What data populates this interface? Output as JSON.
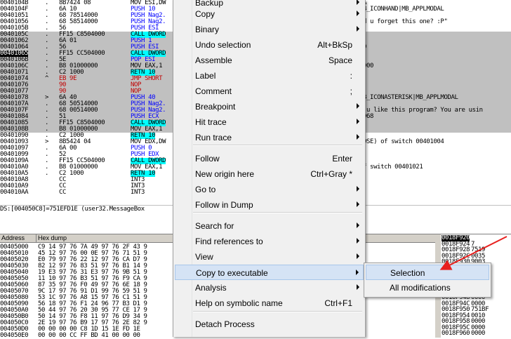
{
  "disasm": {
    "rows": [
      {
        "addr": "0040104B",
        "mark": ".",
        "hex": "8B7424 08",
        "cmd": "MOV ESI,DW",
        "cmt": "FA",
        "sel": false
      },
      {
        "addr": "0040104F",
        "mark": ".",
        "hex": "6A 10",
        "cmd": "PUSH 10",
        "cmt": "MB_ICONHAND|MB_APPLMODAL",
        "sel": false
      },
      {
        "addr": "00401051",
        "mark": ".",
        "hex": "68 78514000",
        "cmd": "PUSH Nag2.",
        "cmt": "",
        "sel": false
      },
      {
        "addr": "00401056",
        "mark": ".",
        "hex": "68 58514000",
        "cmd": "PUSH Nag2.",
        "cmt": "id u forget this one? :P\"",
        "sel": false
      },
      {
        "addr": "0040105B",
        "mark": ".",
        "hex": "56",
        "cmd": "PUSH ESI",
        "cmt": "",
        "sel": false
      },
      {
        "addr": "0040105C",
        "mark": ".",
        "hex": "FF15 C8504000",
        "cmd": "CALL DWORD",
        "cmt": "",
        "sel": true
      },
      {
        "addr": "00401062",
        "mark": ".",
        "hex": "6A 01",
        "cmd": "PUSH 1",
        "cmt": "",
        "sel": true
      },
      {
        "addr": "00401064",
        "mark": ".",
        "hex": "56",
        "cmd": "PUSH ESI",
        "cmt": "30",
        "sel": true
      },
      {
        "addr": "00401065",
        "mark": ".",
        "hex": "FF15 CC504000",
        "cmd": "CALL DWORD",
        "cmt": "",
        "sel": true
      },
      {
        "addr": "0040106B",
        "mark": ".",
        "hex": "5E",
        "cmd": "POP ESI",
        "cmt": "",
        "sel": true
      },
      {
        "addr": "0040106C",
        "mark": ".",
        "hex": "B8 01000000",
        "cmd": "MOV EAX,1",
        "cmt": "1000",
        "sel": true
      },
      {
        "addr": "00401071",
        "mark": ".",
        "hex": "C2 1000",
        "cmd": "RETN 10",
        "cmt": "",
        "sel": true
      },
      {
        "addr": "00401074",
        "mark": "^",
        "hex": "EB 9E",
        "cmd": "JMP SHORT",
        "cmt": "",
        "sel": true
      },
      {
        "addr": "00401076",
        "mark": "",
        "hex": "90",
        "cmd": "NOP",
        "cmt": "",
        "sel": true
      },
      {
        "addr": "00401077",
        "mark": "",
        "hex": "90",
        "cmd": "NOP",
        "cmt": "",
        "sel": true
      },
      {
        "addr": "00401078",
        "mark": ">",
        "hex": "6A 40",
        "cmd": "PUSH 40",
        "cmt": "MB_ICONASTERISK|MB_APPLMODAL",
        "sel": true
      },
      {
        "addr": "0040107A",
        "mark": ".",
        "hex": "68 50514000",
        "cmd": "PUSH Nag2.",
        "cmt": "\"",
        "sel": true
      },
      {
        "addr": "0040107F",
        "mark": ".",
        "hex": "68 00514000",
        "cmd": "PUSH Nag2.",
        "cmt": "o u like this program? You are usin",
        "sel": true
      },
      {
        "addr": "00401084",
        "mark": ".",
        "hex": "51",
        "cmd": "PUSH ECX",
        "cmt": "0D68",
        "sel": true
      },
      {
        "addr": "00401085",
        "mark": ".",
        "hex": "FF15 C8504000",
        "cmd": "CALL DWORD",
        "cmt": "",
        "sel": true
      },
      {
        "addr": "0040108B",
        "mark": ".",
        "hex": "B8 01000000",
        "cmd": "MOV EAX,1",
        "cmt": "",
        "sel": true
      },
      {
        "addr": "00401090",
        "mark": ".",
        "hex": "C2 1000",
        "cmd": "RETN 10",
        "cmt": "",
        "sel": false
      },
      {
        "addr": "00401093",
        "mark": ">",
        "hex": "8B5424 04",
        "cmd": "MOV EDX,DW",
        "cmt": "LOSE) of switch 00401004",
        "sel": false
      },
      {
        "addr": "00401097",
        "mark": ".",
        "hex": "6A 00",
        "cmd": "PUSH 0",
        "cmt": "",
        "sel": false
      },
      {
        "addr": "00401099",
        "mark": ".",
        "hex": "52",
        "cmd": "PUSH EDX",
        "cmt": "",
        "sel": false
      },
      {
        "addr": "0040109A",
        "mark": ".",
        "hex": "FF15 CC504000",
        "cmd": "CALL DWORD",
        "cmt": "",
        "sel": false
      },
      {
        "addr": "004010A0",
        "mark": ".",
        "hex": "B8 01000000",
        "cmd": "MOV EAX,1",
        "cmt": "of switch 00401021",
        "sel": false
      },
      {
        "addr": "004010A5",
        "mark": ".",
        "hex": "C2 1000",
        "cmd": "RETN 10",
        "cmt": "",
        "sel": false
      },
      {
        "addr": "004010A8",
        "mark": "",
        "hex": "CC",
        "cmd": "INT3",
        "cmt": "",
        "sel": false
      },
      {
        "addr": "004010A9",
        "mark": "",
        "hex": "CC",
        "cmd": "INT3",
        "cmt": "",
        "sel": false
      },
      {
        "addr": "004010AA",
        "mark": "",
        "hex": "CC",
        "cmd": "INT3",
        "cmt": "",
        "sel": false
      }
    ],
    "current_addr": "00401065"
  },
  "infoline": "DS:[004050C8]=751EFD1E (user32.MessageBox",
  "dump": {
    "headers": {
      "address": "Address",
      "hex": "Hex dump"
    },
    "rows": [
      {
        "addr": "00405000",
        "hex": "C9 14 97 76 7A 49 97 76 2F 43 9"
      },
      {
        "addr": "00405010",
        "hex": "45 12 97 76 00 0E 97 76 71 51 9"
      },
      {
        "addr": "00405020",
        "hex": "E0 79 97 76 22 12 97 76 CA D7 9"
      },
      {
        "addr": "00405030",
        "hex": "82 12 97 76 83 51 97 76 B1 14 9"
      },
      {
        "addr": "00405040",
        "hex": "19 E3 97 76 31 E3 97 76 9B 51 9"
      },
      {
        "addr": "00405050",
        "hex": "11 10 97 76 B3 51 97 76 F9 CA 9"
      },
      {
        "addr": "00405060",
        "hex": "87 35 97 76 F0 49 97 76 6E 18 9"
      },
      {
        "addr": "00405070",
        "hex": "9C 17 97 76 91 D1 99 76 59 51 9"
      },
      {
        "addr": "00405080",
        "hex": "53 1C 97 76 A8 15 97 76 C1 51 9"
      },
      {
        "addr": "00405090",
        "hex": "56 18 97 76 F1 24 96 77 B3 D1 9"
      },
      {
        "addr": "004050A0",
        "hex": "50 44 97 76 20 30 95 77 CE 17 9"
      },
      {
        "addr": "004050B0",
        "hex": "50 14 97 76 F8 11 97 76 D9 34 9"
      },
      {
        "addr": "004050C0",
        "hex": "2E 19 97 76 B9 17 97 76 2E 82 9"
      },
      {
        "addr": "004050D0",
        "hex": "00 00 00 00 C8 1D 15 1E FD 1E"
      },
      {
        "addr": "004050E0",
        "hex": "00 00 00 CC FF BD 41 00 00 00"
      }
    ]
  },
  "stack": {
    "current": "0018F920",
    "rows": [
      {
        "addr": "0018F920",
        "val": "",
        "cur": true
      },
      {
        "addr": "0018F924",
        "val": "7",
        "cur": false
      },
      {
        "addr": "0018F928",
        "val": "7519",
        "cur": false
      },
      {
        "addr": "0018F92C",
        "val": "0035",
        "cur": false
      },
      {
        "addr": "0018F930",
        "val": "9003",
        "cur": false
      },
      {
        "addr": "0018F934",
        "val": "0035",
        "cur": false
      },
      {
        "addr": "0018F938",
        "val": "0035",
        "cur": false
      },
      {
        "addr": "0018F93C",
        "val": "0010",
        "cur": false
      },
      {
        "addr": "0018F940",
        "val": "DCBAA",
        "cur": false
      },
      {
        "addr": "0018F944",
        "val": "0018",
        "cur": false
      },
      {
        "addr": "0018F948",
        "val": "0000",
        "cur": false
      },
      {
        "addr": "0018F94C",
        "val": "0000",
        "cur": false
      },
      {
        "addr": "0018F950",
        "val": "751BF",
        "cur": false
      },
      {
        "addr": "0018F954",
        "val": "0010",
        "cur": false
      },
      {
        "addr": "0018F958",
        "val": "0000",
        "cur": false
      },
      {
        "addr": "0018F95C",
        "val": "0000",
        "cur": false
      },
      {
        "addr": "0018F960",
        "val": "0000",
        "cur": false
      }
    ]
  },
  "menu": {
    "items": [
      {
        "label": "Backup",
        "shortcut": "",
        "submenu": true
      },
      {
        "label": "Copy",
        "shortcut": "",
        "submenu": true
      },
      {
        "label": "Binary",
        "shortcut": "",
        "submenu": true
      },
      {
        "label": "Undo selection",
        "shortcut": "Alt+BkSp",
        "submenu": false
      },
      {
        "label": "Assemble",
        "shortcut": "Space",
        "submenu": false
      },
      {
        "label": "Label",
        "shortcut": ":",
        "submenu": false
      },
      {
        "label": "Comment",
        "shortcut": ";",
        "submenu": false
      },
      {
        "label": "Breakpoint",
        "shortcut": "",
        "submenu": true
      },
      {
        "label": "Hit trace",
        "shortcut": "",
        "submenu": true
      },
      {
        "label": "Run trace",
        "shortcut": "",
        "submenu": true
      },
      {
        "label": "Follow",
        "shortcut": "Enter",
        "submenu": false
      },
      {
        "label": "New origin here",
        "shortcut": "Ctrl+Gray *",
        "submenu": false
      },
      {
        "label": "Go to",
        "shortcut": "",
        "submenu": true
      },
      {
        "label": "Follow in Dump",
        "shortcut": "",
        "submenu": true
      },
      {
        "label": "Search for",
        "shortcut": "",
        "submenu": true
      },
      {
        "label": "Find references to",
        "shortcut": "",
        "submenu": true
      },
      {
        "label": "View",
        "shortcut": "",
        "submenu": true
      },
      {
        "label": "Copy to executable",
        "shortcut": "",
        "submenu": true
      },
      {
        "label": "Analysis",
        "shortcut": "",
        "submenu": true
      },
      {
        "label": "Help on symbolic name",
        "shortcut": "Ctrl+F1",
        "submenu": false
      },
      {
        "label": "Detach Process",
        "shortcut": "",
        "submenu": false
      }
    ],
    "active": "Copy to executable"
  },
  "submenu": {
    "items": [
      {
        "label": "Selection"
      },
      {
        "label": "All modifications"
      }
    ],
    "active": "Selection"
  },
  "colors": {
    "annotation_arrow": "#e8201e",
    "menu_highlight": "#d5e3f5",
    "selection_grey": "#c0c0c0"
  }
}
